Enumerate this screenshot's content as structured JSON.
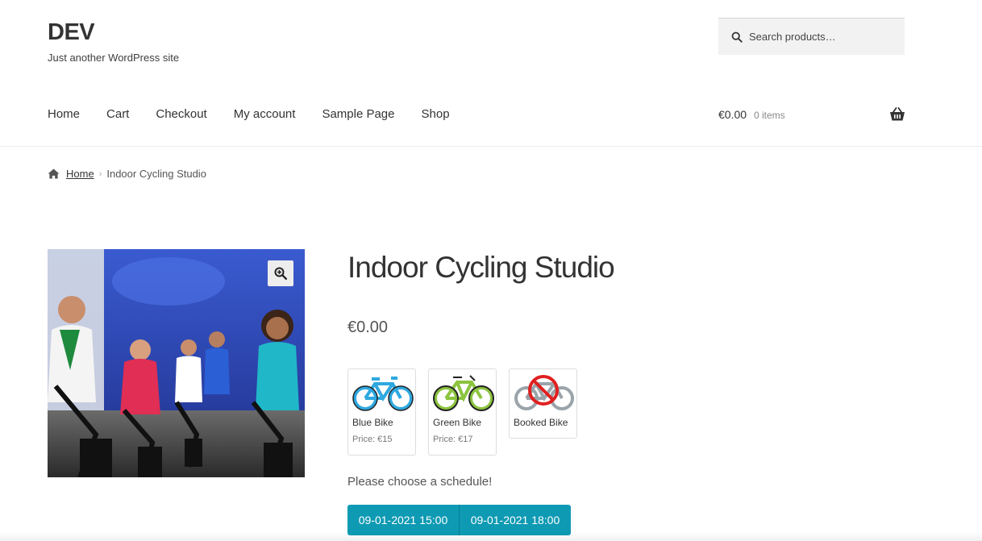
{
  "site": {
    "title": "DEV",
    "description": "Just another WordPress site"
  },
  "search": {
    "placeholder": "Search products…"
  },
  "nav": {
    "items": [
      "Home",
      "Cart",
      "Checkout",
      "My account",
      "Sample Page",
      "Shop"
    ]
  },
  "cart": {
    "total": "€0.00",
    "count": "0 items"
  },
  "breadcrumb": {
    "home": "Home",
    "current": "Indoor Cycling Studio"
  },
  "product": {
    "title": "Indoor Cycling Studio",
    "price": "€0.00",
    "bikes": [
      {
        "name": "Blue Bike",
        "price": "Price: €15",
        "color": "#2fa8e0",
        "icon": "blue-bike-icon"
      },
      {
        "name": "Green Bike",
        "price": "Price: €17",
        "color": "#8cc43f",
        "icon": "green-bike-icon"
      },
      {
        "name": "Booked Bike",
        "price": "",
        "color": "#9aa4aa",
        "icon": "booked-bike-icon"
      }
    ],
    "schedule_label": "Please choose a schedule!",
    "slots": [
      "09-01-2021 15:00",
      "09-01-2021 18:00"
    ]
  },
  "colors": {
    "accent": "#0e9ab3",
    "booked": "#e02020"
  }
}
